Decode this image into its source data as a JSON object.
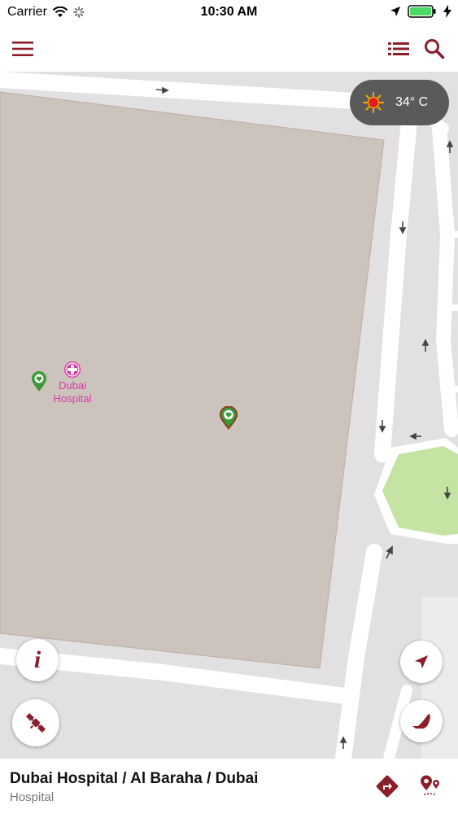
{
  "status_bar": {
    "carrier": "Carrier",
    "time": "10:30 AM"
  },
  "weather": {
    "temperature": "34° C",
    "icon": "sun-icon"
  },
  "map": {
    "poi_label": "Dubai Hospital",
    "poi_icon": "hospital-cross-icon"
  },
  "bottom": {
    "title": "Dubai Hospital / Al Baraha / Dubai",
    "subtitle": "Hospital"
  },
  "colors": {
    "accent": "#8b1e2b",
    "building": "#cdc3bd",
    "park": "#c5e3a3",
    "road": "#ffffff",
    "poi": "#d63aa8",
    "pin": "#3a9a3a"
  }
}
